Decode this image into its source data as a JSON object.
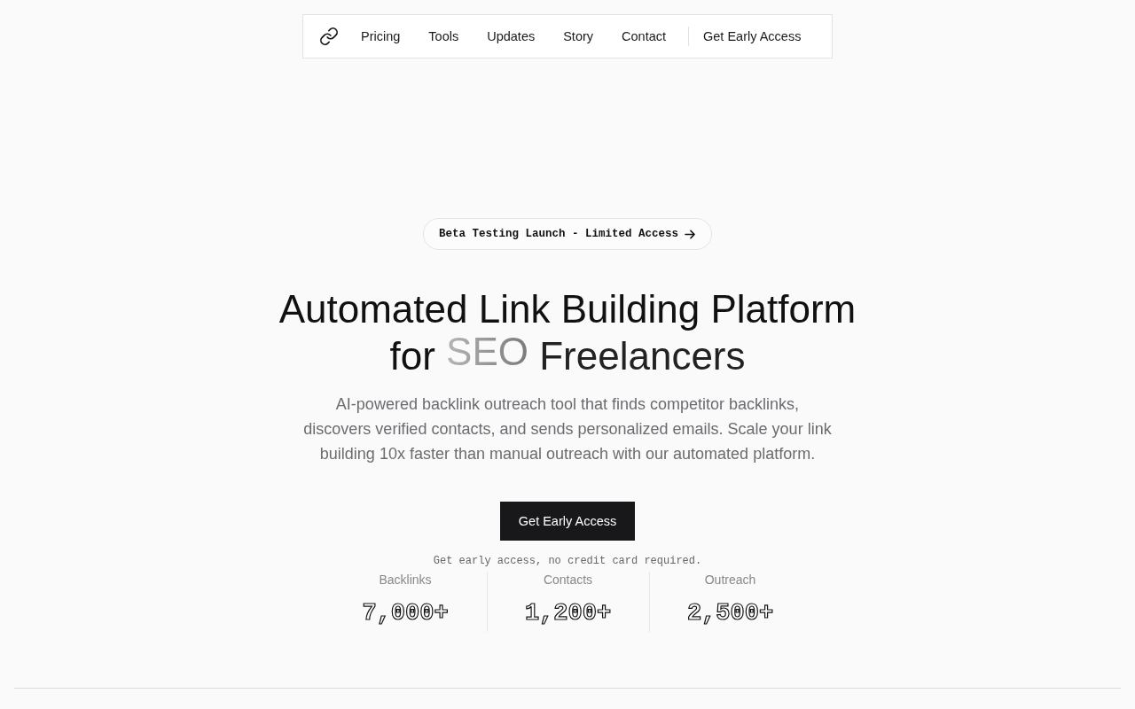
{
  "nav": {
    "items": [
      "Pricing",
      "Tools",
      "Updates",
      "Story",
      "Contact"
    ],
    "cta": "Get Early Access"
  },
  "hero": {
    "badge": "Beta Testing Launch - Limited Access",
    "heading_before": "Automated Link Building Platform for",
    "heading_highlight": "SEO",
    "heading_after": "Freelancers",
    "description": "AI-powered backlink outreach tool that finds competitor backlinks, discovers verified contacts, and sends personalized emails. Scale your link building 10x faster than manual outreach with our automated platform.",
    "button": "Get Early Access",
    "note": "Get early access, no credit card required."
  },
  "stats": [
    {
      "label": "Backlinks",
      "value": "7,000+"
    },
    {
      "label": "Contacts",
      "value": "1,200+"
    },
    {
      "label": "Outreach",
      "value": "2,500+"
    }
  ]
}
